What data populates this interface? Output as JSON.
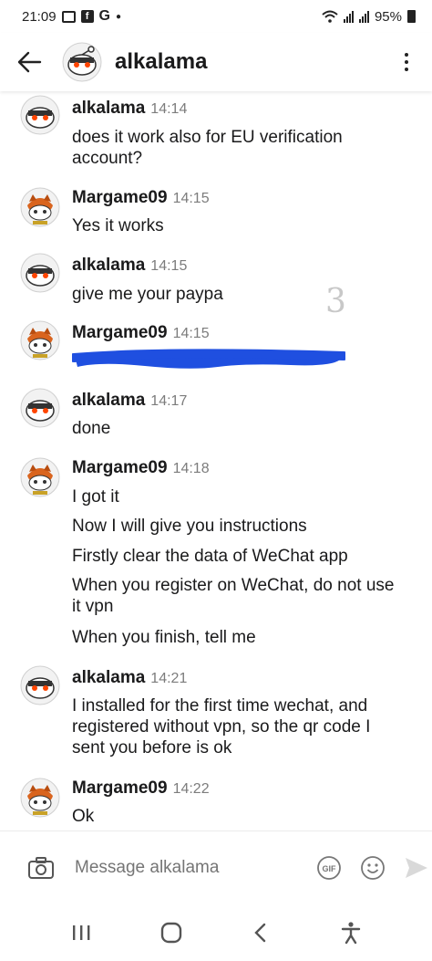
{
  "status_bar": {
    "time": "21:09",
    "g_label": "G",
    "fb_label": "f",
    "battery": "95%",
    "icons": [
      "gallery-icon",
      "facebook-icon",
      "google-icon",
      "dot-icon",
      "wifi-icon",
      "signal-icon",
      "signal-icon",
      "battery-icon"
    ]
  },
  "header": {
    "title": "alkalama",
    "back_icon": "arrow-left-icon",
    "menu_icon": "kebab-menu-icon"
  },
  "messages": [
    {
      "author": "alkalama",
      "time": "14:14",
      "lines": [
        "does it work also for EU verification",
        "account?"
      ]
    },
    {
      "author": "Margame09",
      "time": "14:15",
      "lines": [
        "Yes it works"
      ]
    },
    {
      "author": "alkalama",
      "time": "14:15",
      "lines": [
        "give me your paypa"
      ]
    },
    {
      "author": "Margame09",
      "time": "14:15",
      "lines": []
    },
    {
      "author": "alkalama",
      "time": "14:17",
      "lines": [
        "done"
      ]
    },
    {
      "author": "Margame09",
      "time": "14:18",
      "lines": [
        "I got it",
        "Now I will give you instructions",
        "Firstly clear the data of WeChat app",
        "When you register on WeChat, do not use",
        "it vpn",
        "When you finish, tell me"
      ]
    },
    {
      "author": "alkalama",
      "time": "14:21",
      "lines": [
        "I installed for the first time wechat, and",
        "registered without vpn, so the qr code I",
        "sent you before is ok"
      ]
    },
    {
      "author": "Margame09",
      "time": "14:22",
      "lines": [
        "Ok"
      ]
    }
  ],
  "annotation": "3",
  "composer": {
    "placeholder": "Message alkalama",
    "gif_label": "GIF"
  },
  "colors": {
    "redaction": "#1f4fe0",
    "accent_orange": "#ff4500",
    "text": "#1a1a1b",
    "muted": "#7c7c7c"
  }
}
